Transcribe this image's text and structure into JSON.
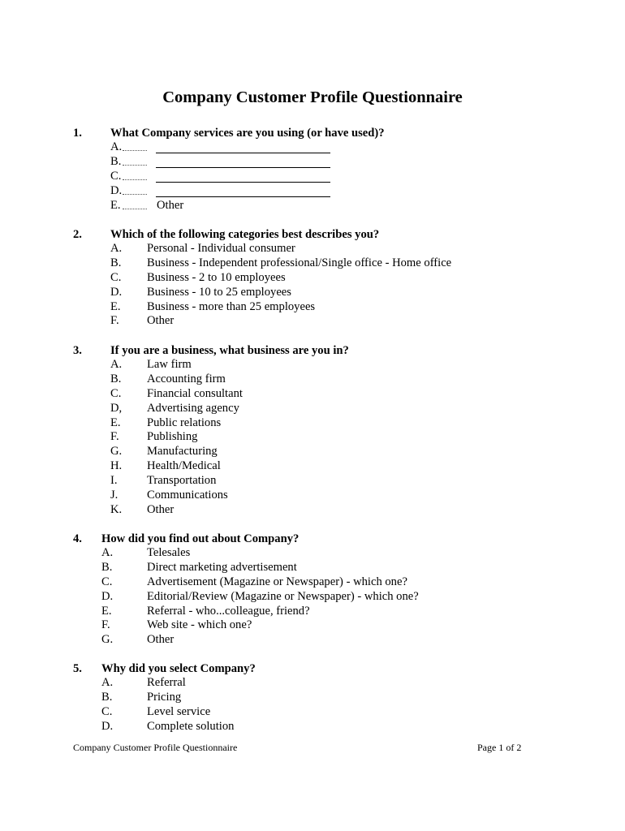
{
  "document": {
    "title": "Company Customer Profile Questionnaire",
    "questions": [
      {
        "number": "1.",
        "text": "What Company services are you using (or have used)?",
        "options": [
          {
            "letter": "A.",
            "label": "",
            "blank": true
          },
          {
            "letter": "B.",
            "label": "",
            "blank": true
          },
          {
            "letter": "C.",
            "label": "",
            "blank": true
          },
          {
            "letter": "D.",
            "label": "",
            "blank": true
          },
          {
            "letter": "E.",
            "label": "Other",
            "blank": false
          }
        ]
      },
      {
        "number": "2.",
        "text": "Which of the following categories best describes you?",
        "options": [
          {
            "letter": "A.",
            "label": "Personal - Individual consumer"
          },
          {
            "letter": "B.",
            "label": "Business - Independent professional/Single office - Home office"
          },
          {
            "letter": "C.",
            "label": "Business - 2 to 10 employees"
          },
          {
            "letter": "D.",
            "label": "Business - 10 to 25 employees"
          },
          {
            "letter": "E.",
            "label": "Business - more than 25 employees"
          },
          {
            "letter": "F.",
            "label": "Other"
          }
        ]
      },
      {
        "number": "3.",
        "text": "If you are a business, what business are you in?",
        "options": [
          {
            "letter": "A.",
            "label": "Law firm"
          },
          {
            "letter": "B.",
            "label": "Accounting firm"
          },
          {
            "letter": "C.",
            "label": "Financial consultant"
          },
          {
            "letter": "D,",
            "label": "Advertising agency"
          },
          {
            "letter": "E.",
            "label": "Public relations"
          },
          {
            "letter": "F.",
            "label": "Publishing"
          },
          {
            "letter": "G.",
            "label": "Manufacturing"
          },
          {
            "letter": "H.",
            "label": "Health/Medical"
          },
          {
            "letter": "I.",
            "label": "Transportation"
          },
          {
            "letter": "J.",
            "label": "Communications"
          },
          {
            "letter": "K.",
            "label": "Other"
          }
        ]
      },
      {
        "number": "4.",
        "text": "How did you find out about Company?",
        "options": [
          {
            "letter": "A.",
            "label": "Telesales"
          },
          {
            "letter": "B.",
            "label": "Direct marketing advertisement"
          },
          {
            "letter": "C.",
            "label": "Advertisement (Magazine or Newspaper) - which one?"
          },
          {
            "letter": "D.",
            "label": "Editorial/Review (Magazine or Newspaper) - which one?"
          },
          {
            "letter": "E.",
            "label": "Referral - who...colleague, friend?"
          },
          {
            "letter": "F.",
            "label": "Web site - which one?"
          },
          {
            "letter": "G.",
            "label": "Other"
          }
        ]
      },
      {
        "number": "5.",
        "text": "Why did you select Company?",
        "options": [
          {
            "letter": "A.",
            "label": "Referral"
          },
          {
            "letter": "B.",
            "label": "Pricing"
          },
          {
            "letter": "C.",
            "label": "Level service"
          },
          {
            "letter": "D.",
            "label": "Complete solution"
          }
        ]
      }
    ],
    "footer": {
      "left": "Company Customer Profile Questionnaire",
      "right": "Page 1 of 2"
    }
  }
}
